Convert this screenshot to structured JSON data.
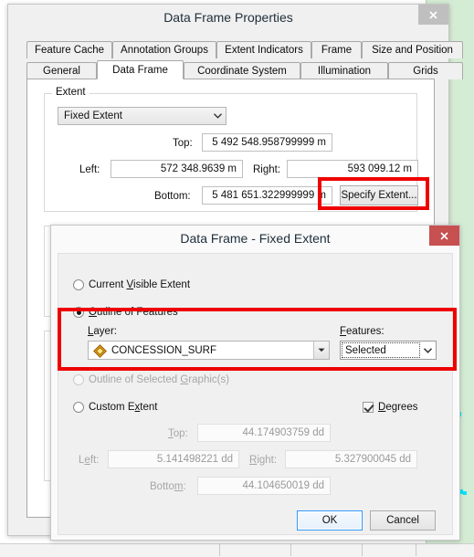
{
  "app": {
    "main_window_title": "Data Frame Properties",
    "close_label": "✕"
  },
  "tabs": {
    "row1": [
      {
        "label": "Feature Cache",
        "active": false
      },
      {
        "label": "Annotation Groups",
        "active": false
      },
      {
        "label": "Extent Indicators",
        "active": false
      },
      {
        "label": "Frame",
        "active": false
      },
      {
        "label": "Size and Position",
        "active": false
      }
    ],
    "row2": [
      {
        "label": "General",
        "active": false
      },
      {
        "label": "Data Frame",
        "active": true
      },
      {
        "label": "Coordinate System",
        "active": false
      },
      {
        "label": "Illumination",
        "active": false
      },
      {
        "label": "Grids",
        "active": false
      }
    ]
  },
  "extent_group": {
    "title": "Extent",
    "mode_value": "Fixed Extent",
    "top_label": "Top:",
    "top_value": "5 492 548.958799999 m",
    "left_label": "Left:",
    "left_value": "572 348.9639 m",
    "right_label": "Right:",
    "right_value": "593 099.12 m",
    "bottom_label": "Bottom:",
    "bottom_value": "5 481 651.322999999 m",
    "specify_extent_label": "Specify Extent..."
  },
  "fixed_extent_dialog": {
    "title": "Data Frame - Fixed Extent",
    "close_label": "✕",
    "current_visible_extent": "Current Visible Extent",
    "outline_of_features": "Outline of Features",
    "layer_label": "Layer:",
    "layer_value": "CONCESSION_SURF",
    "layer_icon": "polygon-symbol-icon",
    "features_label": "Features:",
    "features_value": "Selected",
    "outline_of_selected_graphics": "Outline of Selected Graphic(s)",
    "custom_extent": "Custom Extent",
    "degrees_label": "Degrees",
    "degrees_checked": true,
    "custom": {
      "top_label": "Top:",
      "top_value": "44.174903759 dd",
      "left_label": "Left:",
      "left_value": "5.141498221 dd",
      "right_label": "Right:",
      "right_value": "5.327900045 dd",
      "bottom_label": "Bottom:",
      "bottom_value": "44.104650019 dd"
    },
    "ok_label": "OK",
    "cancel_label": "Cancel"
  },
  "annotations": {
    "color": "#ef0000",
    "boxes": [
      {
        "name": "specify-extent-highlight"
      },
      {
        "name": "outline-of-features-highlight"
      }
    ]
  }
}
